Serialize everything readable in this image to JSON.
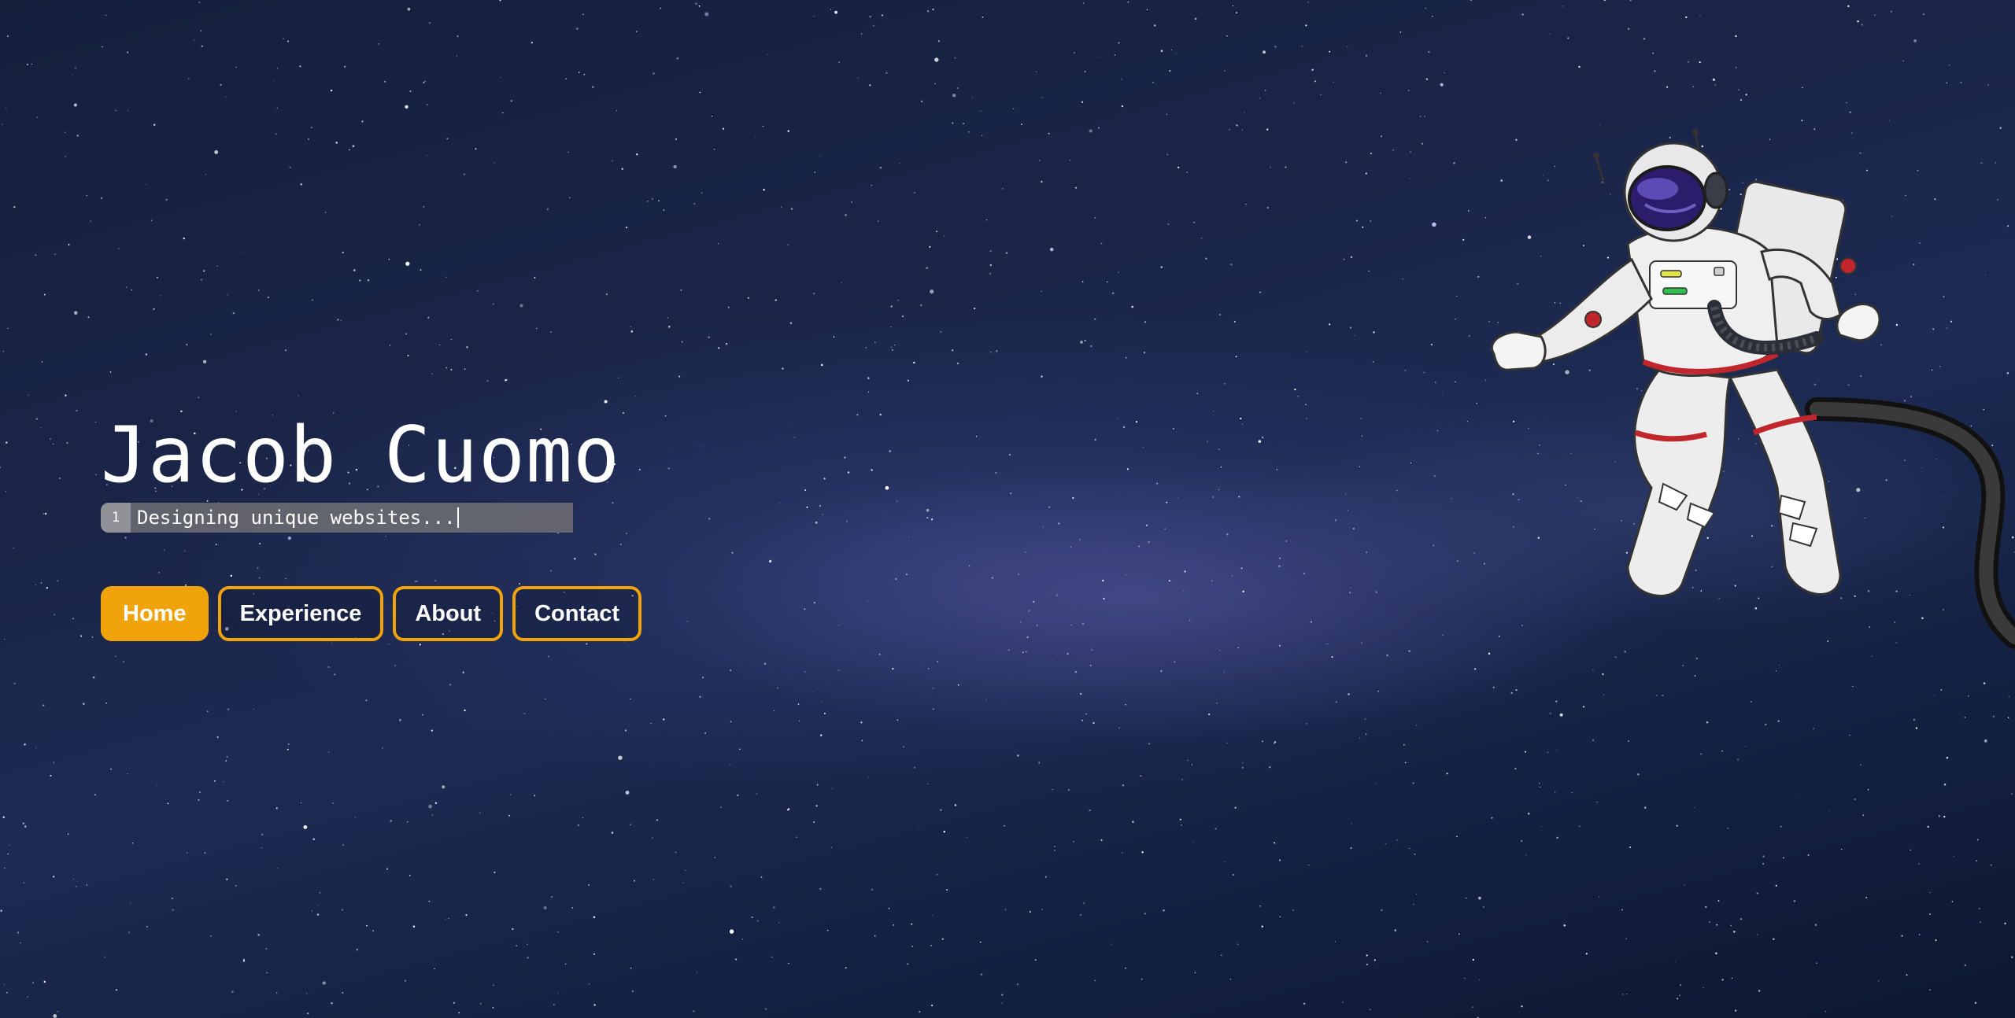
{
  "hero": {
    "name": "Jacob Cuomo",
    "line_number": "1",
    "typed_text": "Designing unique websites..."
  },
  "nav": {
    "items": [
      {
        "label": "Home",
        "active": true
      },
      {
        "label": "Experience",
        "active": false
      },
      {
        "label": "About",
        "active": false
      },
      {
        "label": "Contact",
        "active": false
      }
    ]
  },
  "colors": {
    "accent": "#f0a30a",
    "background": "#1a2548",
    "text": "#ffffff"
  },
  "icons": {
    "illustration": "astronaut-illustration"
  }
}
